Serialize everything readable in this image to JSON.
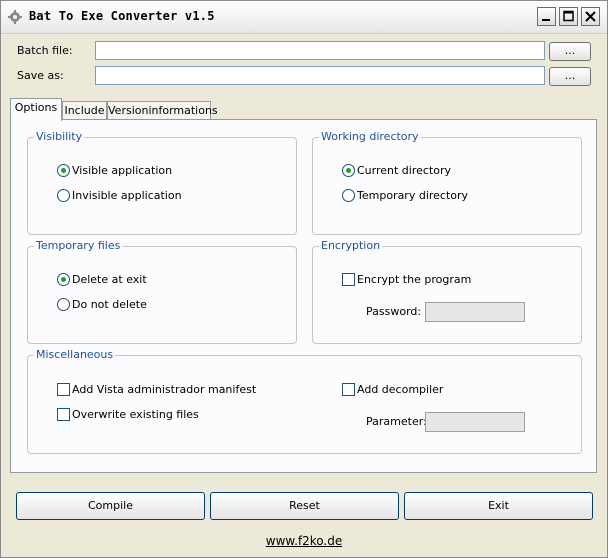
{
  "window": {
    "title": "Bat To Exe Converter v1.5"
  },
  "files": {
    "batch_label": "Batch file:",
    "batch_value": "",
    "save_label": "Save as:",
    "save_value": "",
    "browse_label": "..."
  },
  "tabs": [
    {
      "label": "Options",
      "active": true
    },
    {
      "label": "Include",
      "active": false
    },
    {
      "label": "Versioninformations",
      "active": false
    }
  ],
  "visibility": {
    "title": "Visibility",
    "options": [
      {
        "label": "Visible application",
        "checked": true
      },
      {
        "label": "Invisible application",
        "checked": false
      }
    ]
  },
  "working_directory": {
    "title": "Working directory",
    "options": [
      {
        "label": "Current directory",
        "checked": true
      },
      {
        "label": "Temporary directory",
        "checked": false
      }
    ]
  },
  "temporary_files": {
    "title": "Temporary files",
    "options": [
      {
        "label": "Delete at exit",
        "checked": true
      },
      {
        "label": "Do not delete",
        "checked": false
      }
    ]
  },
  "encryption": {
    "title": "Encryption",
    "encrypt_label": "Encrypt the program",
    "encrypt_checked": false,
    "password_label": "Password:",
    "password_value": ""
  },
  "misc": {
    "title": "Miscellaneous",
    "vista_label": "Add Vista administrador manifest",
    "vista_checked": false,
    "overwrite_label": "Overwrite existing files",
    "overwrite_checked": false,
    "decompiler_label": "Add decompiler",
    "decompiler_checked": false,
    "parameter_label": "Parameter:",
    "parameter_value": ""
  },
  "buttons": {
    "compile": "Compile",
    "reset": "Reset",
    "exit": "Exit"
  },
  "footer": {
    "link": "www.f2ko.de"
  },
  "colors": {
    "group_title": "#1f4fa8",
    "radio_dot": "#21a121",
    "window_bg": "#ece9d8"
  }
}
